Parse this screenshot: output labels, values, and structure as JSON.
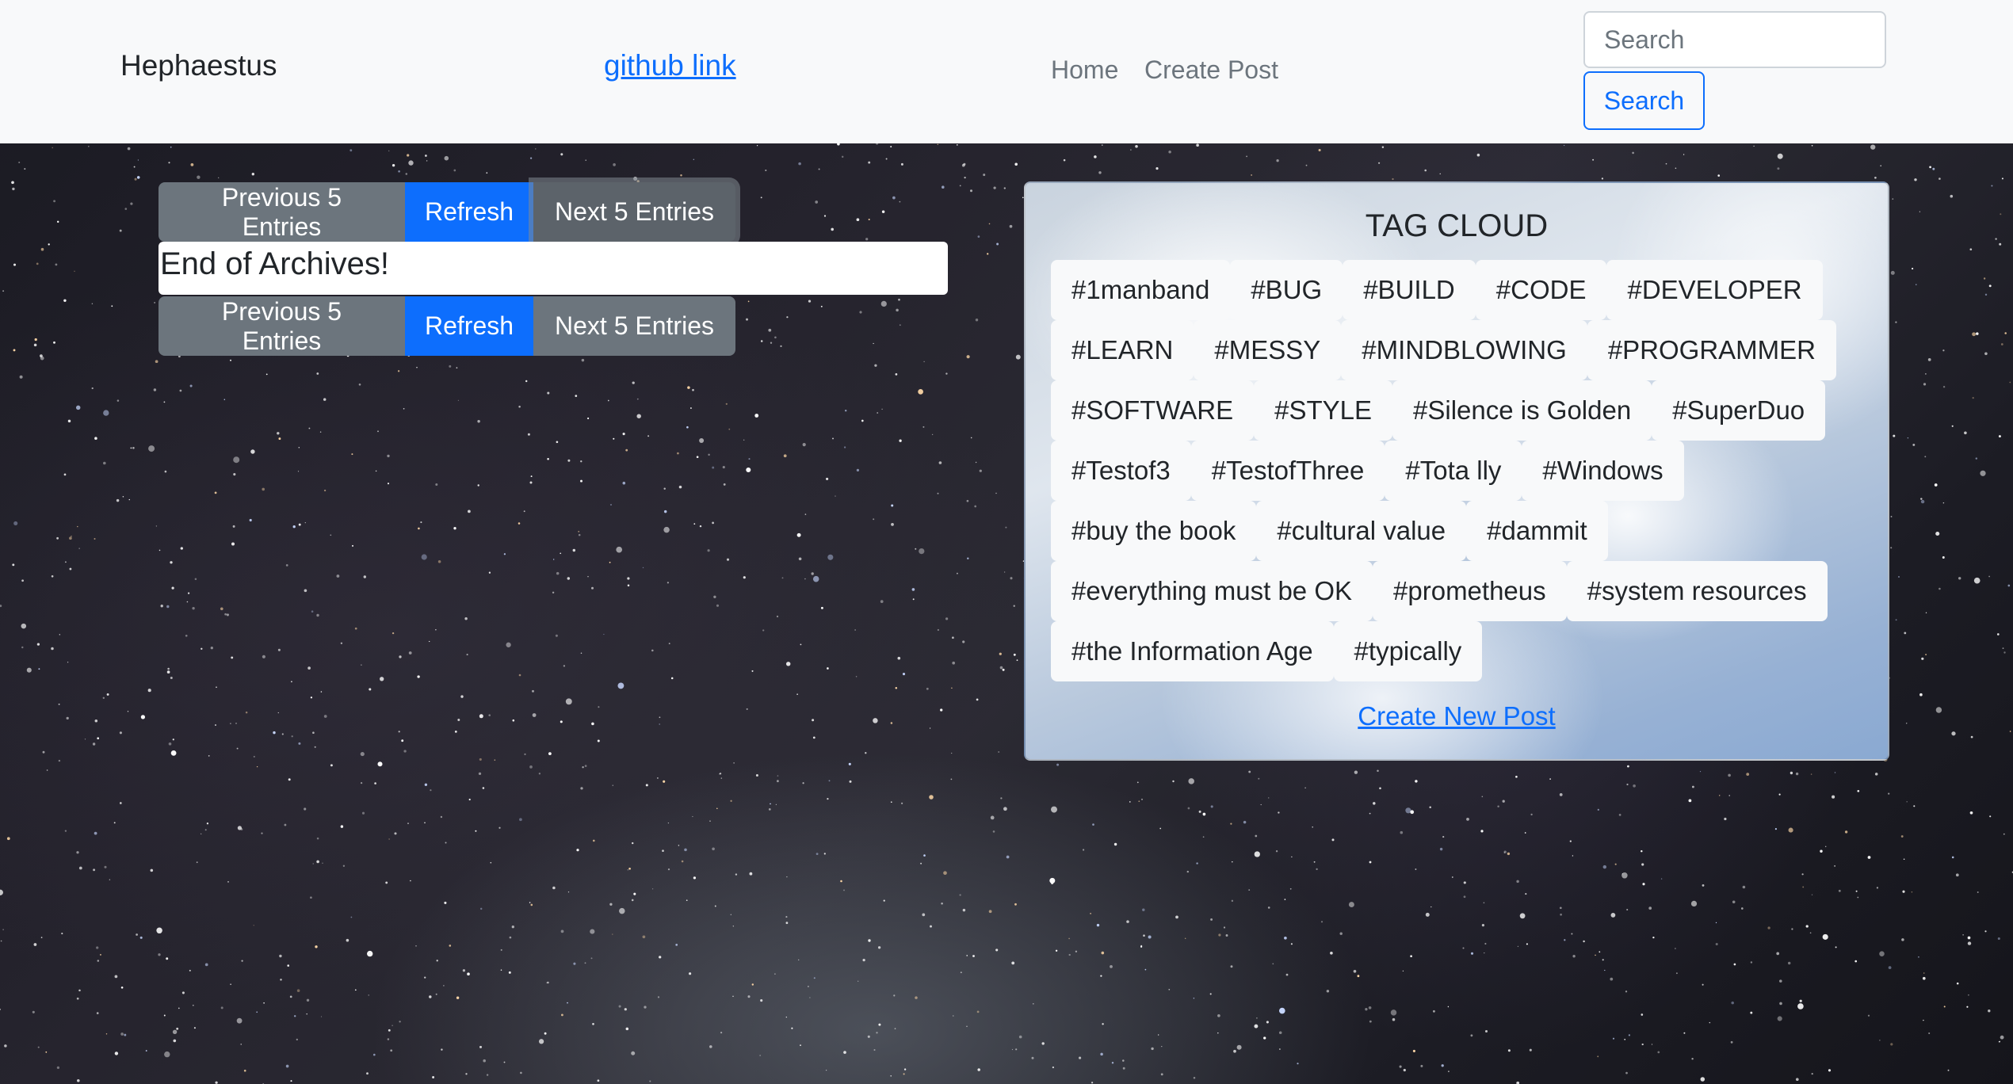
{
  "navbar": {
    "brand": "Hephaestus",
    "github_link": "github link",
    "links": [
      {
        "label": "Home"
      },
      {
        "label": "Create Post"
      }
    ],
    "search": {
      "placeholder": "Search",
      "value": "",
      "button_label": "Search"
    }
  },
  "pager": {
    "previous_label": "Previous 5 Entries",
    "refresh_label": "Refresh",
    "next_label": "Next 5 Entries"
  },
  "archive_message": "End of Archives!",
  "tag_cloud": {
    "title": "TAG CLOUD",
    "tags": [
      "#1manband",
      "#BUG",
      "#BUILD",
      "#CODE",
      "#DEVELOPER",
      "#LEARN",
      "#MESSY",
      "#MINDBLOWING",
      "#PROGRAMMER",
      "#SOFTWARE",
      "#STYLE",
      "#Silence is Golden",
      "#SuperDuo",
      "#Testof3",
      "#TestofThree",
      "#Tota lly",
      "#Windows",
      "#buy the book",
      "#cultural value",
      "#dammit",
      "#everything must be OK",
      "#prometheus",
      "#system resources",
      "#the Information Age",
      "#typically"
    ],
    "create_link": "Create New Post"
  },
  "colors": {
    "primary": "#0d6efd",
    "secondary": "#6c757d",
    "navbar_bg": "#f8f9fa"
  }
}
